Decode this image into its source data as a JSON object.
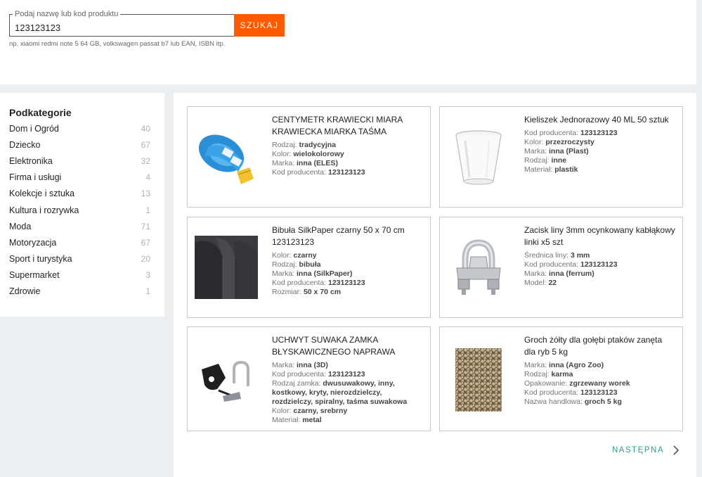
{
  "search": {
    "legend": "Podaj nazwę lub kod produktu",
    "value": "123123123",
    "button_label": "SZUKAJ",
    "hint": "np. xiaomi redmi note 5 64 GB, volkswagen passat b7 lub EAN, ISBN itp."
  },
  "sidebar": {
    "title": "Podkategorie",
    "items": [
      {
        "label": "Dom i Ogród",
        "count": "40"
      },
      {
        "label": "Dziecko",
        "count": "67"
      },
      {
        "label": "Elektronika",
        "count": "32"
      },
      {
        "label": "Firma i usługi",
        "count": "4"
      },
      {
        "label": "Kolekcje i sztuka",
        "count": "13"
      },
      {
        "label": "Kultura i rozrywka",
        "count": "1"
      },
      {
        "label": "Moda",
        "count": "71"
      },
      {
        "label": "Motoryzacja",
        "count": "67"
      },
      {
        "label": "Sport i turystyka",
        "count": "20"
      },
      {
        "label": "Supermarket",
        "count": "3"
      },
      {
        "label": "Zdrowie",
        "count": "1"
      }
    ]
  },
  "products": [
    {
      "title": "CENTYMETR KRAWIECKI MIARA KRAWIECKA MIARKA TAŚMA",
      "icon": "tape-measure-image",
      "attrs": [
        {
          "k": "Rodzaj: ",
          "v": "tradycyjna"
        },
        {
          "k": "Kolor: ",
          "v": "wielokolorowy"
        },
        {
          "k": "Marka: ",
          "v": "inna (ELES)"
        },
        {
          "k": "Kod producenta: ",
          "v": "123123123"
        }
      ]
    },
    {
      "title": "Kieliszek Jednorazowy 40 ML 50 sztuk",
      "icon": "plastic-cup-image",
      "attrs": [
        {
          "k": "Kod producenta: ",
          "v": "123123123"
        },
        {
          "k": "Kolor: ",
          "v": "przezroczysty"
        },
        {
          "k": "Marka: ",
          "v": "inna (Plast)"
        },
        {
          "k": "Rodzaj: ",
          "v": "inne"
        },
        {
          "k": "Materiał: ",
          "v": "plastik"
        }
      ]
    },
    {
      "title": "Bibuła SilkPaper czarny 50 x 70 cm 123123123",
      "icon": "tissue-paper-image",
      "attrs": [
        {
          "k": "Kolor: ",
          "v": "czarny"
        },
        {
          "k": "Rodzaj: ",
          "v": "bibuła"
        },
        {
          "k": "Marka: ",
          "v": "inna (SilkPaper)"
        },
        {
          "k": "Kod producenta: ",
          "v": "123123123"
        },
        {
          "k": "Rozmiar: ",
          "v": "50 x 70 cm"
        }
      ]
    },
    {
      "title": "Zacisk liny 3mm ocynkowany kabłąkowy linki x5 szt",
      "icon": "wire-clamp-image",
      "attrs": [
        {
          "k": "Średnica liny: ",
          "v": "3 mm"
        },
        {
          "k": "Kod producenta: ",
          "v": "123123123"
        },
        {
          "k": "Marka: ",
          "v": "inna (ferrum)"
        },
        {
          "k": "Model: ",
          "v": "22"
        }
      ]
    },
    {
      "title": "UCHWYT SUWAKA ZAMKA BŁYSKAWICZNEGO NAPRAWA",
      "icon": "zipper-slider-image",
      "attrs": [
        {
          "k": "Marka: ",
          "v": "inna (3D)"
        },
        {
          "k": "Kod producenta: ",
          "v": "123123123"
        },
        {
          "k": "Rodzaj zamka: ",
          "v": "dwusuwakowy, inny, kostkowy, kryty, nierozdzielczy, rozdzielczy, spiralny, taśma suwakowa"
        },
        {
          "k": "Kolor: ",
          "v": "czarny, srebrny"
        },
        {
          "k": "Materiał: ",
          "v": "metal"
        }
      ]
    },
    {
      "title": "Groch żółty dla gołębi ptaków zanęta dla ryb 5 kg",
      "icon": "yellow-peas-image",
      "attrs": [
        {
          "k": "Marka: ",
          "v": "inna (Agro Zoo)"
        },
        {
          "k": "Rodzaj: ",
          "v": "karma"
        },
        {
          "k": "Opakowanie: ",
          "v": "zgrzewany worek"
        },
        {
          "k": "Kod producenta: ",
          "v": "123123123"
        },
        {
          "k": "Nazwa handlowa: ",
          "v": "groch 5 kg"
        }
      ]
    }
  ],
  "pagination": {
    "next_label": "NASTĘPNA",
    "next_icon": "chevron-right-icon"
  }
}
